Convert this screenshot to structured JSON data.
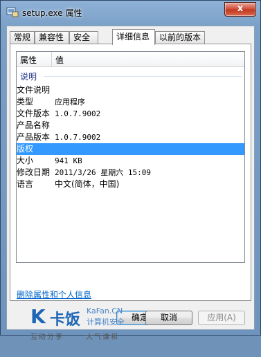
{
  "window": {
    "title": "setup.exe 属性",
    "close_label": "x"
  },
  "tabs": [
    {
      "label": "常规"
    },
    {
      "label": "兼容性"
    },
    {
      "label": "安全"
    },
    {
      "label": "详细信息"
    },
    {
      "label": "以前的版本"
    }
  ],
  "list": {
    "headers": {
      "property": "属性",
      "value": "值"
    },
    "group_label": "说明",
    "rows": [
      {
        "key": "文件说明",
        "value": ""
      },
      {
        "key": "类型",
        "value": "应用程序"
      },
      {
        "key": "文件版本",
        "value": "1.0.7.9002"
      },
      {
        "key": "产品名称",
        "value": ""
      },
      {
        "key": "产品版本",
        "value": "1.0.7.9002"
      },
      {
        "key": "版权",
        "value": ""
      },
      {
        "key": "大小",
        "value": "941 KB"
      },
      {
        "key": "修改日期",
        "value": "2011/3/26 星期六 15:09"
      },
      {
        "key": "语言",
        "value": "中文(简体，中国)"
      }
    ]
  },
  "footer": {
    "remove_link": "删除属性和个人信息",
    "ok_label": "确定",
    "cancel_label": "取消",
    "apply_label": "应用(A)"
  },
  "watermark": {
    "brand": "卡饭",
    "site": "KaFan.CN",
    "tag": "计算机安全",
    "slogan_left": "互助分享",
    "slogan_right": "大气谦和"
  },
  "colors": {
    "selection": "#3399ff",
    "link": "#0066cc",
    "group_text": "#1e3287"
  }
}
